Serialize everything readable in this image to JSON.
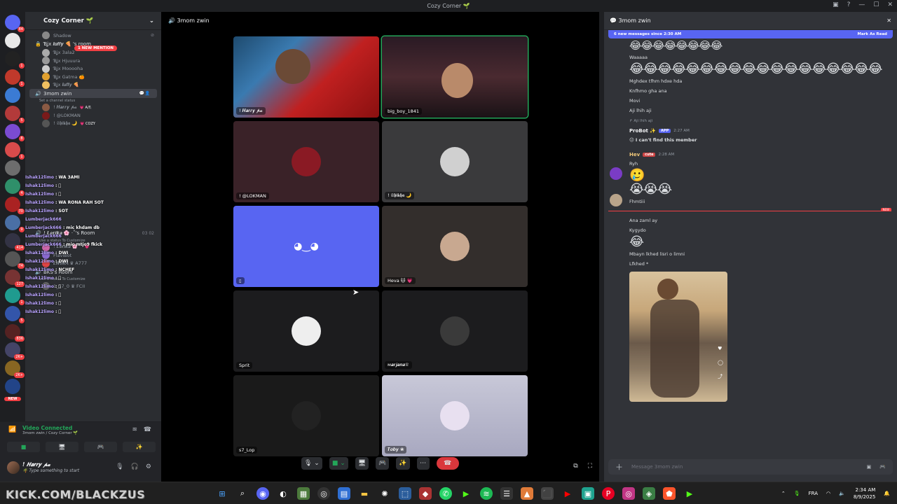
{
  "window": {
    "title": "Cozy Corner 🌱"
  },
  "rail": {
    "servers": [
      {
        "color": "#5865f2",
        "badge": "84"
      },
      {
        "color": "#e8e8e8",
        "badge": ""
      },
      {
        "color": "#222222",
        "badge": "1"
      },
      {
        "color": "#c0392b",
        "badge": "1"
      },
      {
        "color": "#3b7bd4",
        "badge": ""
      },
      {
        "color": "#b33a3a",
        "badge": "5"
      },
      {
        "color": "#7b4bd1",
        "badge": "8"
      },
      {
        "color": "#d94b4b",
        "badge": "1"
      },
      {
        "color": "#6d6d6d",
        "badge": ""
      },
      {
        "color": "#2f8f6a",
        "badge": "4"
      },
      {
        "color": "#aa2222",
        "badge": "70"
      },
      {
        "color": "#4a6fa5",
        "badge": "9"
      },
      {
        "color": "#333344",
        "badge": "414"
      },
      {
        "color": "#555555",
        "badge": "74"
      },
      {
        "color": "#773333",
        "badge": "127"
      },
      {
        "color": "#1f9b8f",
        "badge": "1"
      },
      {
        "color": "#3355aa",
        "badge": "5"
      },
      {
        "color": "#552222",
        "badge": "836"
      },
      {
        "color": "#444466",
        "badge": "2K+"
      },
      {
        "color": "#886622",
        "badge": "2K+"
      },
      {
        "color": "#224488",
        "badge": ""
      }
    ],
    "new_label": "NEW"
  },
  "sidebar": {
    "server_name": "Cozy Corner 🌱",
    "mention_pill": "1 NEW MENTION",
    "top_user": "Shadow",
    "luffy_room": {
      "name": "Ɓʝx 𝒍𝒖𝒇𝒇𝒚 🍕 's room",
      "users": [
        "Ɓʝx 3ala2",
        "Ɓʝx Hjuuura",
        "Ɓʝx Mooooha",
        "Ɓʝx Gatma 🍊",
        "Ɓʝx 𝒍𝒖𝒇𝒇𝒚 🍕"
      ]
    },
    "voice_channel": {
      "name": "3mom zwin",
      "status": "Set a channel status",
      "users": [
        {
          "name": "! 𝑯𝒂𝒓𝒓𝒚 𝓹𝓪",
          "tag": "💗 A爪"
        },
        {
          "name": "! @LOKMAN",
          "tag": ""
        },
        {
          "name": "! 𝕾𝖍𝖎𝖐𝖍𝖆 🌙",
          "tag": "💗 COZY"
        },
        {
          "name": "big_boy_1841",
          "tag": ""
        },
        {
          "name": "Heva 🐱 💗",
          "tag": "cute"
        },
        {
          "name": "ᴍ𝒂𝒓𝒋𝒂𝒏𝒂♕",
          "tag": ""
        },
        {
          "name": "s7_Lop",
          "tag": ""
        }
      ]
    },
    "lerika_room": {
      "name": "! 𝑳𝒆𝒓𝒊𝒌𝒂 🌸 ·˚'s Room",
      "status": "Use a status To Customize",
      "counts": [
        "03",
        "02"
      ],
      "users": [
        "! 𝑳𝒆𝒓𝒊𝒌𝒂 🌸 ·˚ 💗 ཻ",
        "FlaviBot",
        "𝑳𝑾𝑰𝑵𝑨 ♛ A777"
      ]
    },
    "bks_room": {
      "name": "BKS's Room",
      "status": "Use a status To Customize",
      "users": [
        "1_57_0 ♛ FCII"
      ]
    }
  },
  "overlay_chat": [
    {
      "name": "Ishak12limo",
      "text": " : WA 3AMI"
    },
    {
      "name": "Ishak12limo",
      "text": " : 🏻"
    },
    {
      "name": "Ishak12limo",
      "text": " : 🏻"
    },
    {
      "name": "Ishak12limo",
      "text": " : WA RONA RAH SOT"
    },
    {
      "name": "Ishak12limo",
      "text": " : SOT"
    },
    {
      "name": "Lumberjack666",
      "text": ""
    },
    {
      "name": "Lumberjack666",
      "text": " : mic khdam db"
    },
    {
      "name": "Lumberjack666",
      "text": ""
    },
    {
      "name": "Lumberjack666",
      "text": " : mic mtjo9 fkick"
    },
    {
      "name": "Ishak12limo",
      "text": " : DWI"
    },
    {
      "name": "Ishak12limo",
      "text": " : DWI"
    },
    {
      "name": "Ishak12limo",
      "text": " : NCHEF"
    },
    {
      "name": "Ishak12limo",
      "text": " : 🏻"
    },
    {
      "name": "Ishak12limo",
      "text": " : 🏻"
    },
    {
      "name": "Ishak12limo",
      "text": " : 🏻"
    },
    {
      "name": "Ishak12limo",
      "text": " : 🏻"
    },
    {
      "name": "Ishak12limo",
      "text": " : 🏻"
    }
  ],
  "voice_panel": {
    "status": "Video Connected",
    "location": "3mom zwin / Cozy Corner 🌱"
  },
  "user_panel": {
    "name": "! 𝑯𝒂𝒓𝒓𝒚 𝓹𝓪",
    "status": "🌴 Type something to start"
  },
  "stage": {
    "channel": "3mom zwin",
    "tiles": [
      {
        "label": "! 𝑯𝒂𝒓𝒓𝒚 𝓹𝓪",
        "kind": "video-red"
      },
      {
        "label": "big_boy_1841",
        "kind": "video-dark"
      },
      {
        "label": "! @LOKMAN",
        "kind": "avatar-maroon"
      },
      {
        "label": "! 𝕾𝖍𝖎𝖐𝖍𝖆 🌙",
        "kind": "avatar-grey"
      },
      {
        "label": "",
        "kind": "discord"
      },
      {
        "label": "Heva 🐱 💗",
        "kind": "avatar-brown"
      },
      {
        "label": "Sprit",
        "kind": "avatar-anime"
      },
      {
        "label": "ᴍ𝒂𝒓𝒋𝒂𝒏𝒂♕",
        "kind": "avatar-dark"
      },
      {
        "label": "s7_Lop",
        "kind": "avatar-black"
      },
      {
        "label": "𝑻𝒐𝒃𝒚 ❀",
        "kind": "avatar-light"
      }
    ]
  },
  "chat": {
    "channel": "3mom zwin",
    "new_messages": "6 new messages since 2:30 AM",
    "mark_read": "Mark As Read",
    "messages_top": [
      "Waaaaa",
      "Mghdex tfhm hdxe hda",
      "Knfhmo gha ana",
      "Movi",
      "Aji lhih aji"
    ],
    "probot": {
      "reply": "Aji lhih aji",
      "name": "ProBot ✨",
      "tag": "APP",
      "time": "2:27 AM",
      "text": "I can't find this member"
    },
    "heva": {
      "name": "Hev",
      "tag": "cute",
      "time": "2:28 AM",
      "lines": [
        "Ryh",
        "Fhmtiii"
      ]
    },
    "new_label": "NEW",
    "messages_bottom": [
      "Ana zaml ay",
      "Kygydo",
      "Mbayn lkhed lisri o limni",
      "Lfkhed *"
    ],
    "composer_placeholder": "Message 3mom zwin"
  },
  "taskbar": {
    "watermark": "KICK.COM/BLACKZUS",
    "lang": "FRA",
    "time": "2:34 AM",
    "date": "8/9/2025"
  }
}
